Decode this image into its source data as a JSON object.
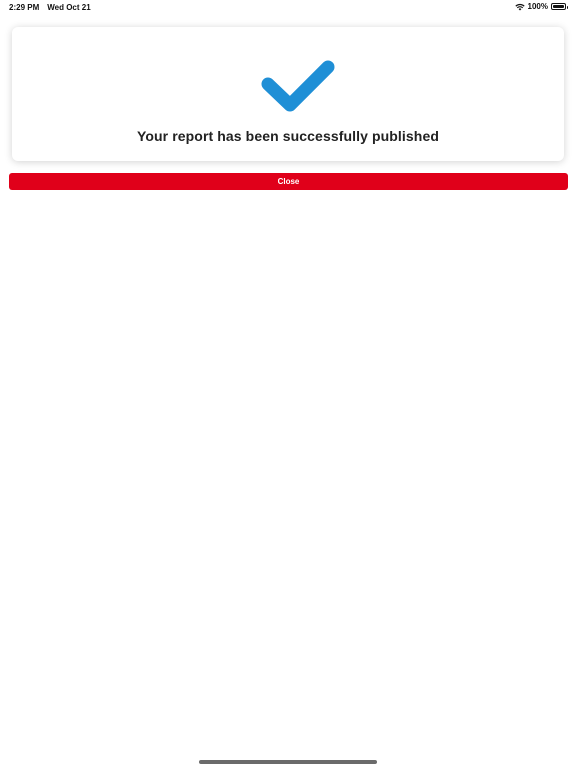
{
  "status_bar": {
    "time": "2:29 PM",
    "date": "Wed Oct 21",
    "battery": "100%",
    "wifi_icon": "wifi-icon",
    "battery_icon": "battery-icon"
  },
  "card": {
    "icon": "checkmark-icon",
    "icon_color": "#1f8fd6",
    "message": "Your report has been successfully published"
  },
  "actions": {
    "close_label": "Close",
    "close_color": "#e0001a"
  }
}
